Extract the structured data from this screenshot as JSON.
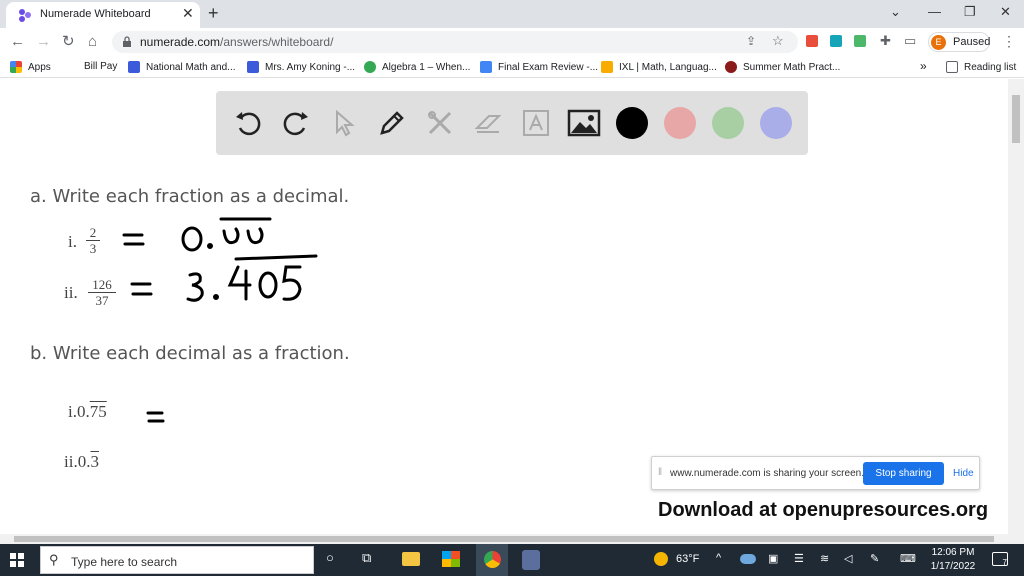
{
  "browser": {
    "tab_title": "Numerade Whiteboard",
    "tab_close": "✕",
    "new_tab": "+",
    "url_domain": "numerade.com",
    "url_path": "/answers/whiteboard/",
    "profile_initial": "E",
    "profile_status": "Paused",
    "bookmarks": [
      {
        "label": "Apps",
        "color": "#e84335"
      },
      {
        "label": "Bill Pay",
        "color": "#ffffff"
      },
      {
        "label": "National Math and...",
        "color": "#3b5bdb"
      },
      {
        "label": "Mrs. Amy Koning -...",
        "color": "#3b5bdb"
      },
      {
        "label": "Algebra 1 – When...",
        "color": "#34a853"
      },
      {
        "label": "Final Exam Review -...",
        "color": "#4285f4"
      },
      {
        "label": "IXL | Math, Languag...",
        "color": "#f9ab00"
      },
      {
        "label": "Summer Math Pract...",
        "color": "#8b1a1a"
      }
    ],
    "bookmarks_more": "»",
    "reading_list": "Reading list"
  },
  "whiteboard": {
    "colors": {
      "black": "#000000",
      "pink": "#e8a7a7",
      "green": "#a8cfa3",
      "purple": "#aaaee8"
    },
    "part_a": "a. Write each fraction as a decimal.",
    "part_a_items": [
      {
        "label": "i.",
        "numerator": "2",
        "denominator": "3",
        "answer": "= 0.66"
      },
      {
        "label": "ii.",
        "numerator": "126",
        "denominator": "37",
        "answer": "= 3.405"
      }
    ],
    "part_b": "b. Write each decimal as a fraction.",
    "part_b_items": [
      {
        "label": "i.",
        "value_int": "0.",
        "value_rep": "75",
        "answer": "="
      },
      {
        "label": "ii.",
        "value_int": "0.",
        "value_rep": "3"
      }
    ]
  },
  "share_banner": {
    "text": "www.numerade.com is sharing your screen.",
    "stop_label": "Stop sharing",
    "hide_label": "Hide"
  },
  "footer_text": "Download at openupresources.org",
  "taskbar": {
    "search_placeholder": "Type here to search",
    "weather": "63°F",
    "time": "12:06 PM",
    "date": "1/17/2022",
    "notifications": "7"
  }
}
